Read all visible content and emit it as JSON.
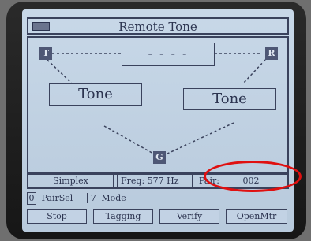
{
  "screen": {
    "title": "Remote Tone",
    "center_display": "- - - -",
    "nodes": {
      "transmit": "T",
      "receive": "R",
      "ground": "G"
    },
    "left_tone_label": "Tone",
    "right_tone_label": "Tone"
  },
  "status": {
    "mode": "Simplex",
    "freq": "Freq:  577 Hz",
    "pair_label": "Pair:",
    "pair_value": "002"
  },
  "info": {
    "pairsel_num": "0",
    "pairsel_label": "PairSel",
    "mode_num": "7",
    "mode_label": "Mode"
  },
  "softkeys": [
    "Stop",
    "Tagging",
    "Verify",
    "OpenMtr"
  ],
  "colors": {
    "screen_bg": "#c0d2e4",
    "text": "#2c3450",
    "highlight": "#e01010"
  }
}
